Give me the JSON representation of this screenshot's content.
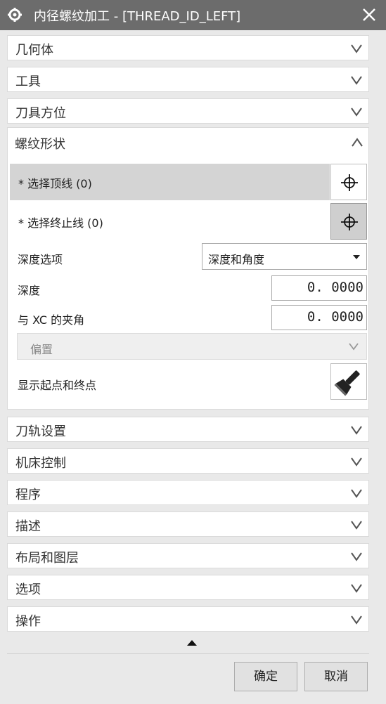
{
  "window": {
    "title": "内径螺纹加工 - [THREAD_ID_LEFT]"
  },
  "sections_top": [
    "几何体",
    "工具",
    "刀具方位"
  ],
  "thread_shape": {
    "title": "螺纹形状",
    "select_top_line": "* 选择顶线 (0)",
    "select_end_line": "* 选择终止线 (0)",
    "depth_option_label": "深度选项",
    "depth_option_value": "深度和角度",
    "depth_label": "深度",
    "depth_value": "0. 0000",
    "angle_label": "与 XC 的夹角",
    "angle_value": "0. 0000",
    "offset_label": "偏置",
    "show_points_label": "显示起点和终点"
  },
  "sections_bottom": [
    "刀轨设置",
    "机床控制",
    "程序",
    "描述",
    "布局和图层",
    "选项",
    "操作"
  ],
  "footer": {
    "ok": "确定",
    "cancel": "取消"
  }
}
